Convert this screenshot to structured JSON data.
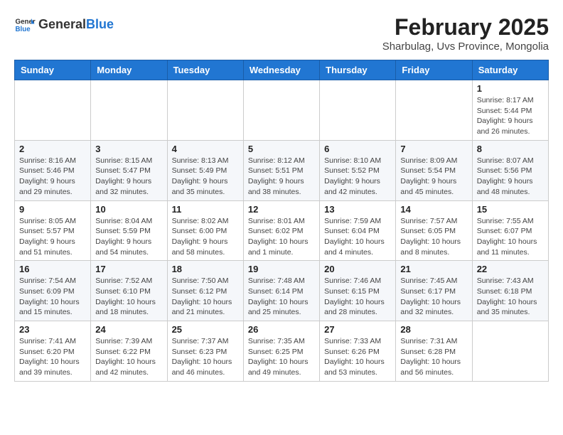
{
  "header": {
    "logo_general": "General",
    "logo_blue": "Blue",
    "month_year": "February 2025",
    "location": "Sharbulag, Uvs Province, Mongolia"
  },
  "days_of_week": [
    "Sunday",
    "Monday",
    "Tuesday",
    "Wednesday",
    "Thursday",
    "Friday",
    "Saturday"
  ],
  "weeks": [
    [
      {
        "day": "",
        "info": ""
      },
      {
        "day": "",
        "info": ""
      },
      {
        "day": "",
        "info": ""
      },
      {
        "day": "",
        "info": ""
      },
      {
        "day": "",
        "info": ""
      },
      {
        "day": "",
        "info": ""
      },
      {
        "day": "1",
        "info": "Sunrise: 8:17 AM\nSunset: 5:44 PM\nDaylight: 9 hours and 26 minutes."
      }
    ],
    [
      {
        "day": "2",
        "info": "Sunrise: 8:16 AM\nSunset: 5:46 PM\nDaylight: 9 hours and 29 minutes."
      },
      {
        "day": "3",
        "info": "Sunrise: 8:15 AM\nSunset: 5:47 PM\nDaylight: 9 hours and 32 minutes."
      },
      {
        "day": "4",
        "info": "Sunrise: 8:13 AM\nSunset: 5:49 PM\nDaylight: 9 hours and 35 minutes."
      },
      {
        "day": "5",
        "info": "Sunrise: 8:12 AM\nSunset: 5:51 PM\nDaylight: 9 hours and 38 minutes."
      },
      {
        "day": "6",
        "info": "Sunrise: 8:10 AM\nSunset: 5:52 PM\nDaylight: 9 hours and 42 minutes."
      },
      {
        "day": "7",
        "info": "Sunrise: 8:09 AM\nSunset: 5:54 PM\nDaylight: 9 hours and 45 minutes."
      },
      {
        "day": "8",
        "info": "Sunrise: 8:07 AM\nSunset: 5:56 PM\nDaylight: 9 hours and 48 minutes."
      }
    ],
    [
      {
        "day": "9",
        "info": "Sunrise: 8:05 AM\nSunset: 5:57 PM\nDaylight: 9 hours and 51 minutes."
      },
      {
        "day": "10",
        "info": "Sunrise: 8:04 AM\nSunset: 5:59 PM\nDaylight: 9 hours and 54 minutes."
      },
      {
        "day": "11",
        "info": "Sunrise: 8:02 AM\nSunset: 6:00 PM\nDaylight: 9 hours and 58 minutes."
      },
      {
        "day": "12",
        "info": "Sunrise: 8:01 AM\nSunset: 6:02 PM\nDaylight: 10 hours and 1 minute."
      },
      {
        "day": "13",
        "info": "Sunrise: 7:59 AM\nSunset: 6:04 PM\nDaylight: 10 hours and 4 minutes."
      },
      {
        "day": "14",
        "info": "Sunrise: 7:57 AM\nSunset: 6:05 PM\nDaylight: 10 hours and 8 minutes."
      },
      {
        "day": "15",
        "info": "Sunrise: 7:55 AM\nSunset: 6:07 PM\nDaylight: 10 hours and 11 minutes."
      }
    ],
    [
      {
        "day": "16",
        "info": "Sunrise: 7:54 AM\nSunset: 6:09 PM\nDaylight: 10 hours and 15 minutes."
      },
      {
        "day": "17",
        "info": "Sunrise: 7:52 AM\nSunset: 6:10 PM\nDaylight: 10 hours and 18 minutes."
      },
      {
        "day": "18",
        "info": "Sunrise: 7:50 AM\nSunset: 6:12 PM\nDaylight: 10 hours and 21 minutes."
      },
      {
        "day": "19",
        "info": "Sunrise: 7:48 AM\nSunset: 6:14 PM\nDaylight: 10 hours and 25 minutes."
      },
      {
        "day": "20",
        "info": "Sunrise: 7:46 AM\nSunset: 6:15 PM\nDaylight: 10 hours and 28 minutes."
      },
      {
        "day": "21",
        "info": "Sunrise: 7:45 AM\nSunset: 6:17 PM\nDaylight: 10 hours and 32 minutes."
      },
      {
        "day": "22",
        "info": "Sunrise: 7:43 AM\nSunset: 6:18 PM\nDaylight: 10 hours and 35 minutes."
      }
    ],
    [
      {
        "day": "23",
        "info": "Sunrise: 7:41 AM\nSunset: 6:20 PM\nDaylight: 10 hours and 39 minutes."
      },
      {
        "day": "24",
        "info": "Sunrise: 7:39 AM\nSunset: 6:22 PM\nDaylight: 10 hours and 42 minutes."
      },
      {
        "day": "25",
        "info": "Sunrise: 7:37 AM\nSunset: 6:23 PM\nDaylight: 10 hours and 46 minutes."
      },
      {
        "day": "26",
        "info": "Sunrise: 7:35 AM\nSunset: 6:25 PM\nDaylight: 10 hours and 49 minutes."
      },
      {
        "day": "27",
        "info": "Sunrise: 7:33 AM\nSunset: 6:26 PM\nDaylight: 10 hours and 53 minutes."
      },
      {
        "day": "28",
        "info": "Sunrise: 7:31 AM\nSunset: 6:28 PM\nDaylight: 10 hours and 56 minutes."
      },
      {
        "day": "",
        "info": ""
      }
    ]
  ]
}
